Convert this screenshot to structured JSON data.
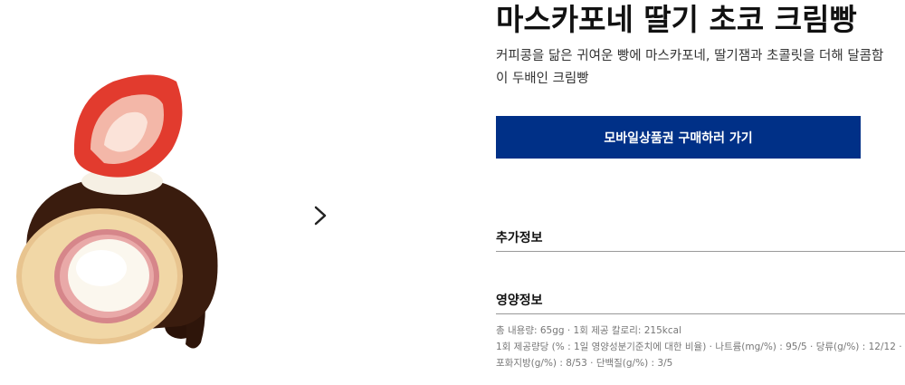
{
  "product": {
    "title": "마스카포네 딸기 초코 크림빵",
    "description": "커피콩을 닮은 귀여운 빵에 마스카포네, 딸기잼과 초콜릿을 더해 달콤함이 두배인 크림빵"
  },
  "actions": {
    "buy_label": "모바일상품권 구매하러 가기",
    "next_icon": "chevron-right-icon"
  },
  "sections": {
    "extra_info": "추가정보",
    "nutrition": "영양정보"
  },
  "nutrition": {
    "line1": "총 내용량: 65gg · 1회 제공 칼로리: 215kcal",
    "line2": "1회 제공량당 (% : 1일 영양성분기준치에 대한 비율) · 나트륨(mg/%) : 95/5 · 당류(g/%) : 12/12 ·",
    "line3": "포화지방(g/%) : 8/53 · 단백질(g/%) : 3/5"
  },
  "colors": {
    "button_bg": "#003087",
    "divider": "#999999"
  }
}
